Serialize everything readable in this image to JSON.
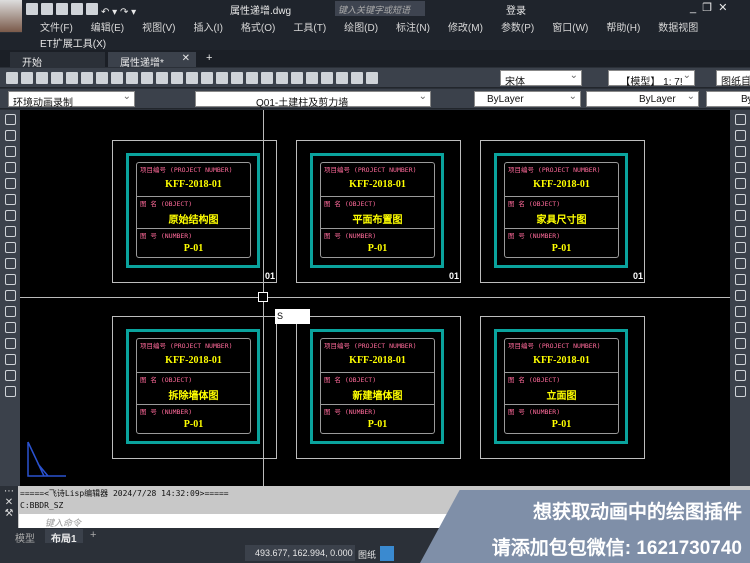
{
  "title": {
    "filename": "属性递增.dwg",
    "search_placeholder": "键入关键字或短语",
    "login": "登录"
  },
  "menu": [
    "文件(F)",
    "编辑(E)",
    "视图(V)",
    "插入(I)",
    "格式(O)",
    "工具(T)",
    "绘图(D)",
    "标注(N)",
    "修改(M)",
    "参数(P)",
    "窗口(W)",
    "帮助(H)",
    "数据视图"
  ],
  "menu_row2": "ET扩展工具(X)",
  "tabs": [
    {
      "label": "开始"
    },
    {
      "label": "属性递增*"
    }
  ],
  "toolbar1": {
    "font": "宋体",
    "scale": "【模型】 1: 7!",
    "sheet": "图纸目录"
  },
  "toolbar2": {
    "workspace": "环境动画录制",
    "layer": "Q01-土建柱及剪力墙",
    "color": "ByLayer",
    "linetype": "ByLayer",
    "lineweight": "By"
  },
  "sheets": [
    {
      "proj_label": "项目编号 (PROJECT NUMBER)",
      "proj": "KFF-2018-01",
      "name_label": "图 名 (OBJECT)",
      "name": "原始结构图",
      "num_label": "图 号 (NUMBER)",
      "num": "P-01",
      "corner": "01"
    },
    {
      "proj_label": "项目编号 (PROJECT NUMBER)",
      "proj": "KFF-2018-01",
      "name_label": "图 名 (OBJECT)",
      "name": "平面布置图",
      "num_label": "图 号 (NUMBER)",
      "num": "P-01",
      "corner": "01"
    },
    {
      "proj_label": "项目编号 (PROJECT NUMBER)",
      "proj": "KFF-2018-01",
      "name_label": "图 名 (OBJECT)",
      "name": "家具尺寸图",
      "num_label": "图 号 (NUMBER)",
      "num": "P-01",
      "corner": "01"
    },
    {
      "proj_label": "项目编号 (PROJECT NUMBER)",
      "proj": "KFF-2018-01",
      "name_label": "图 名 (OBJECT)",
      "name": "拆除墙体图",
      "num_label": "图 号 (NUMBER)",
      "num": "P-01",
      "corner": ""
    },
    {
      "proj_label": "项目编号 (PROJECT NUMBER)",
      "proj": "KFF-2018-01",
      "name_label": "图 名 (OBJECT)",
      "name": "新建墙体图",
      "num_label": "图 号 (NUMBER)",
      "num": "P-01",
      "corner": ""
    },
    {
      "proj_label": "项目编号 (PROJECT NUMBER)",
      "proj": "KFF-2018-01",
      "name_label": "图 名 (OBJECT)",
      "name": "立面图",
      "num_label": "图 号 (NUMBER)",
      "num": "P-01",
      "corner": ""
    }
  ],
  "dyn_input": "S",
  "command": {
    "history1": "=====<飞诗Lisp编辑器 2024/7/28 14:32:09>=====",
    "history2": "C:BBDR_SZ",
    "placeholder": "键入命令"
  },
  "layout_tabs": [
    "模型",
    "布局1"
  ],
  "status": {
    "coords": "493.677, 162.994, 0.000",
    "space": "图纸"
  },
  "promo": {
    "line1": "想获取动画中的绘图插件",
    "line2": "请添加包包微信: 1621730740"
  }
}
